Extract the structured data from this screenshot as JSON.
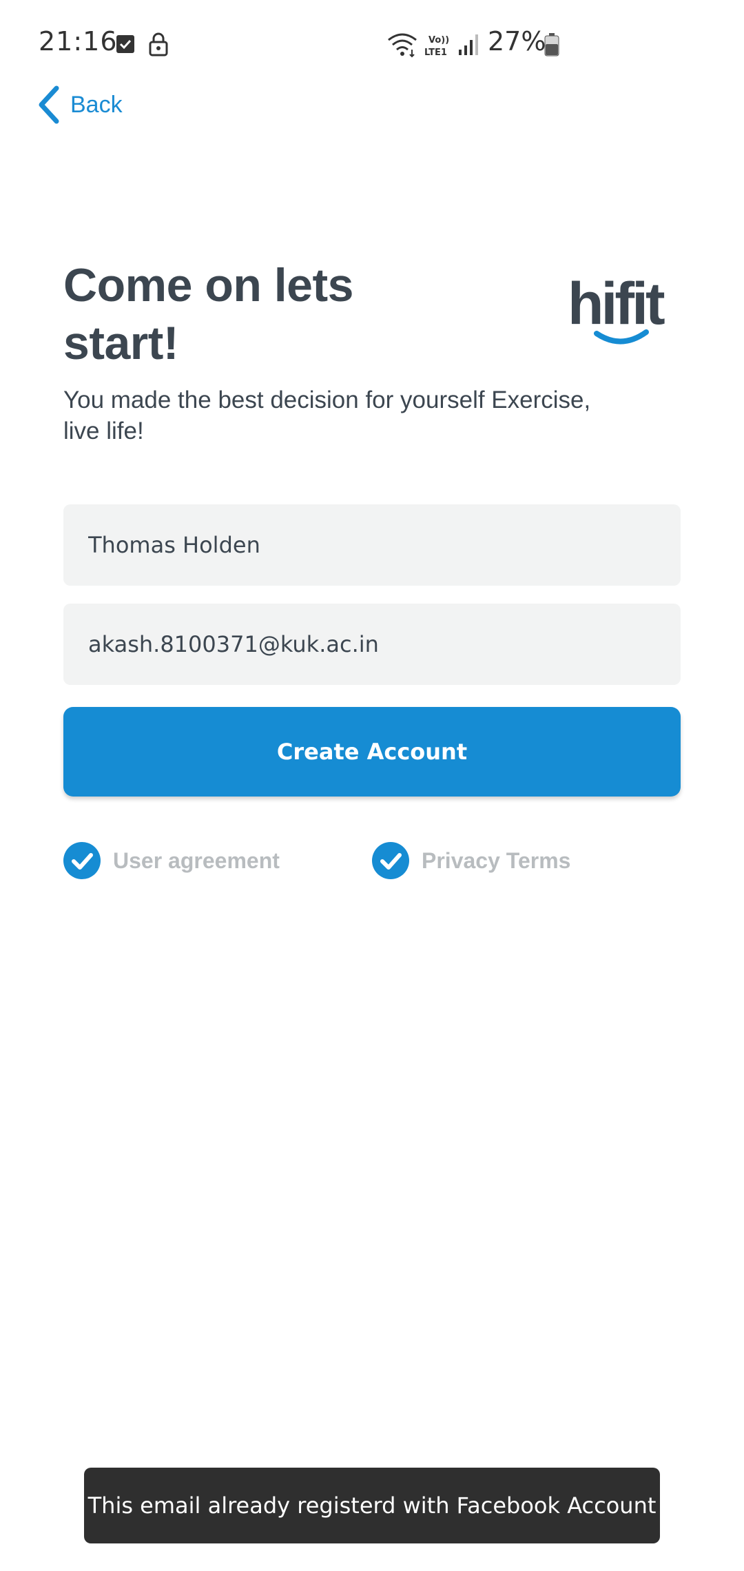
{
  "status_bar": {
    "time": "21:16",
    "battery": "27%",
    "network_label": "Vo)) LTE1",
    "icons": [
      "checkbox-icon",
      "lock-icon",
      "wifi-icon",
      "volte-icon",
      "signal-icon",
      "battery-icon"
    ]
  },
  "nav": {
    "back_label": "Back"
  },
  "header": {
    "title": "Come on lets start!",
    "subtitle": "You made the best decision for yourself Exercise, live life!",
    "logo_text": "hifit"
  },
  "form": {
    "name_value": "Thomas Holden",
    "email_value": "akash.8100371@kuk.ac.in",
    "submit_label": "Create Account"
  },
  "agreements": {
    "user_label": "User agreement",
    "privacy_label": "Privacy Terms",
    "user_checked": true,
    "privacy_checked": true
  },
  "toast": {
    "message": "This email already registerd with Facebook Account"
  },
  "colors": {
    "accent": "#168cd3",
    "text": "#3c4650",
    "field_bg": "#f2f3f3",
    "muted": "#b8bcbf",
    "toast_bg": "#2f2f2f"
  }
}
